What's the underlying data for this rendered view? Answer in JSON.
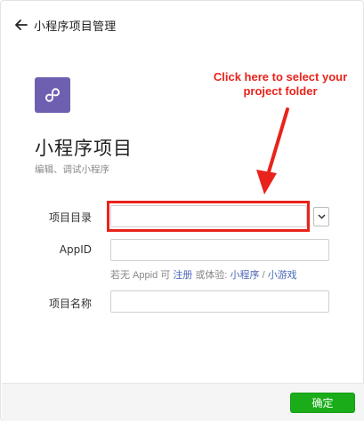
{
  "header": {
    "title": "小程序项目管理",
    "back_icon": "arrow-left-icon"
  },
  "annotation": {
    "text": "Click here to select your project folder",
    "color": "#e8231b"
  },
  "app": {
    "icon": "mini-program-logo-icon",
    "icon_color": "#6f5fb0",
    "title": "小程序项目",
    "subtitle": "编辑、调试小程序"
  },
  "form": {
    "project_dir": {
      "label": "项目目录",
      "value": ""
    },
    "appid": {
      "label": "AppID",
      "value": ""
    },
    "hint": {
      "prefix": "若无 Appid 可",
      "register_link": "注册",
      "middle": "或体验:",
      "mini_program_link": "小程序",
      "separator": "/",
      "mini_game_link": "小游戏"
    },
    "project_name": {
      "label": "项目名称",
      "value": ""
    }
  },
  "footer": {
    "confirm_label": "确定",
    "confirm_color": "#1aad19"
  }
}
